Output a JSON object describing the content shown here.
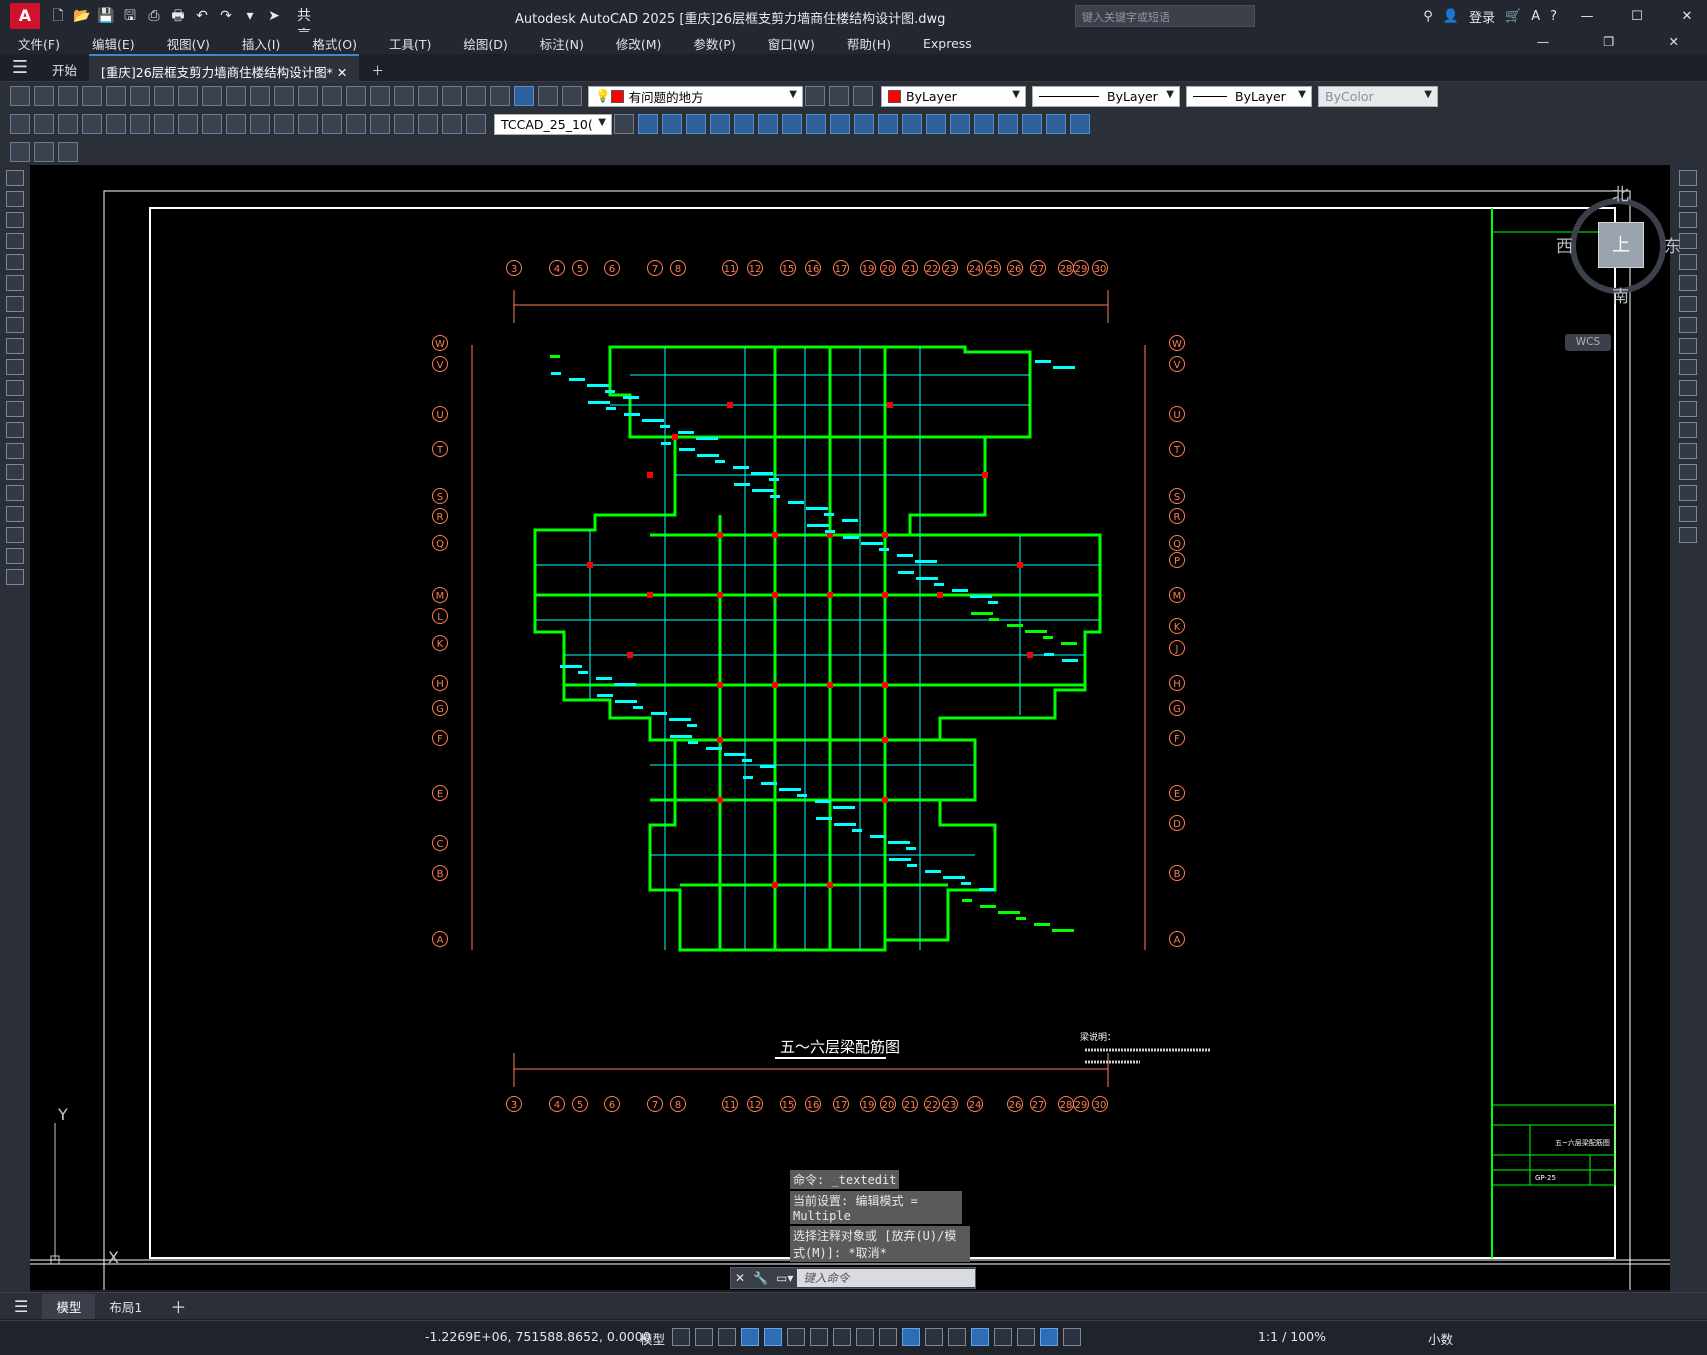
{
  "titlebar": {
    "app_logo": "A",
    "share_label": "共享",
    "window_title": "Autodesk AutoCAD 2025    [重庆]26层框支剪力墙商住楼结构设计图.dwg",
    "search_placeholder": "键入关键字或短语",
    "login_label": "登录"
  },
  "menubar": {
    "items": [
      "文件(F)",
      "编辑(E)",
      "视图(V)",
      "插入(I)",
      "格式(O)",
      "工具(T)",
      "绘图(D)",
      "标注(N)",
      "修改(M)",
      "参数(P)",
      "窗口(W)",
      "帮助(H)",
      "Express"
    ]
  },
  "tabs": {
    "start": "开始",
    "document": "[重庆]26层框支剪力墙商住楼结构设计图*"
  },
  "toolbar": {
    "layer_name": "有问题的地方",
    "color": "ByLayer",
    "linetype": "ByLayer",
    "lineweight": "ByLayer",
    "plotstyle": "ByColor",
    "textstyle": "TCCAD_25_10("
  },
  "viewcube": {
    "north": "北",
    "south": "南",
    "east": "东",
    "west": "西",
    "face": "上",
    "wcs": "WCS"
  },
  "drawing": {
    "col_axes_top": [
      "3",
      "4",
      "5",
      "6",
      "7",
      "8",
      "11",
      "12",
      "15",
      "16",
      "17",
      "19",
      "20",
      "21",
      "22",
      "23",
      "24",
      "25",
      "26",
      "27",
      "28",
      "29",
      "30"
    ],
    "col_axes_bottom": [
      "3",
      "4",
      "5",
      "6",
      "7",
      "8",
      "11",
      "12",
      "15",
      "16",
      "17",
      "19",
      "20",
      "21",
      "22",
      "23",
      "24",
      "26",
      "27",
      "28",
      "29",
      "30"
    ],
    "row_axes_left": [
      "W",
      "V",
      "U",
      "T",
      "S",
      "R",
      "Q",
      "M",
      "L",
      "K",
      "H",
      "G",
      "F",
      "E",
      "C",
      "B",
      "A"
    ],
    "row_axes_right": [
      "W",
      "V",
      "U",
      "T",
      "S",
      "R",
      "Q",
      "P",
      "M",
      "K",
      "J",
      "H",
      "G",
      "F",
      "E",
      "D",
      "B",
      "A"
    ],
    "plan_title": "五～六层梁配筋图",
    "notes_title": "梁说明：",
    "titleblock_name": "五~六层梁配筋图",
    "titleblock_no": "GP-25"
  },
  "command": {
    "line1": "命令: _textedit",
    "line2": "当前设置: 编辑模式 = Multiple",
    "line3": "选择注释对象或 [放弃(U)/模式(M)]: *取消*",
    "input_placeholder": "键入命令"
  },
  "layout_tabs": {
    "model": "模型",
    "layout1": "布局1"
  },
  "statusbar": {
    "coordinates": "-1.2269E+06, 751588.8652, 0.0000",
    "mode": "模型",
    "scale": "1:1 / 100%",
    "units": "小数"
  },
  "colors": {
    "accent": "#3f86d1",
    "wall_green": "#00ff00",
    "rebar_cyan": "#00ffff",
    "axis_orange": "#ff7f50",
    "column_red": "#ff0000"
  }
}
